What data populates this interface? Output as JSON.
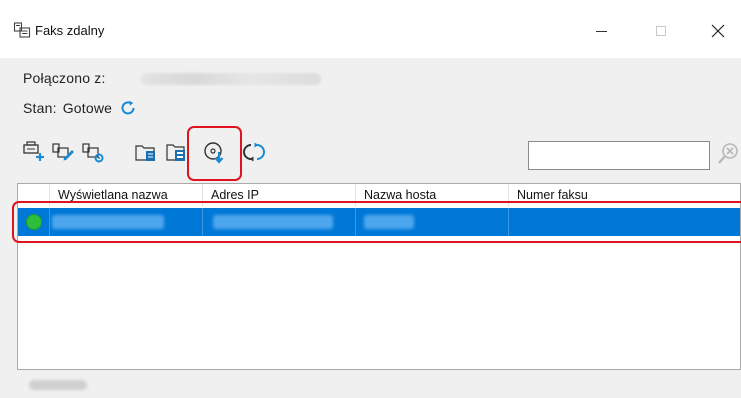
{
  "window": {
    "title": "Faks zdalny",
    "minimize_icon": "minimize-icon",
    "maximize_icon": "maximize-icon",
    "close_icon": "close-icon"
  },
  "connection": {
    "label": "Połączono z:",
    "value": ""
  },
  "status": {
    "label": "Stan:",
    "value": "Gotowe",
    "refresh_icon": "refresh-icon"
  },
  "toolbar": {
    "buttons": [
      {
        "icon": "add-printer-icon"
      },
      {
        "icon": "printer-edit-icon"
      },
      {
        "icon": "printer-settings-icon"
      },
      {
        "icon": "fax-folder-icon"
      },
      {
        "icon": "fax-document-icon"
      },
      {
        "icon": "download-disc-icon"
      },
      {
        "icon": "sync-icon"
      }
    ],
    "search_placeholder": "",
    "search_icon": "search-clear-icon"
  },
  "table": {
    "columns": [
      "Wyświetlana nazwa",
      "Adres IP",
      "Nazwa hosta",
      "Numer faksu"
    ],
    "rows": [
      {
        "status": "online",
        "name": "",
        "ip": "",
        "host": "",
        "fax": ""
      }
    ]
  },
  "colors": {
    "accent": "#0078d7",
    "highlight": "#e0141e",
    "status_ok": "#2dbf3c"
  }
}
